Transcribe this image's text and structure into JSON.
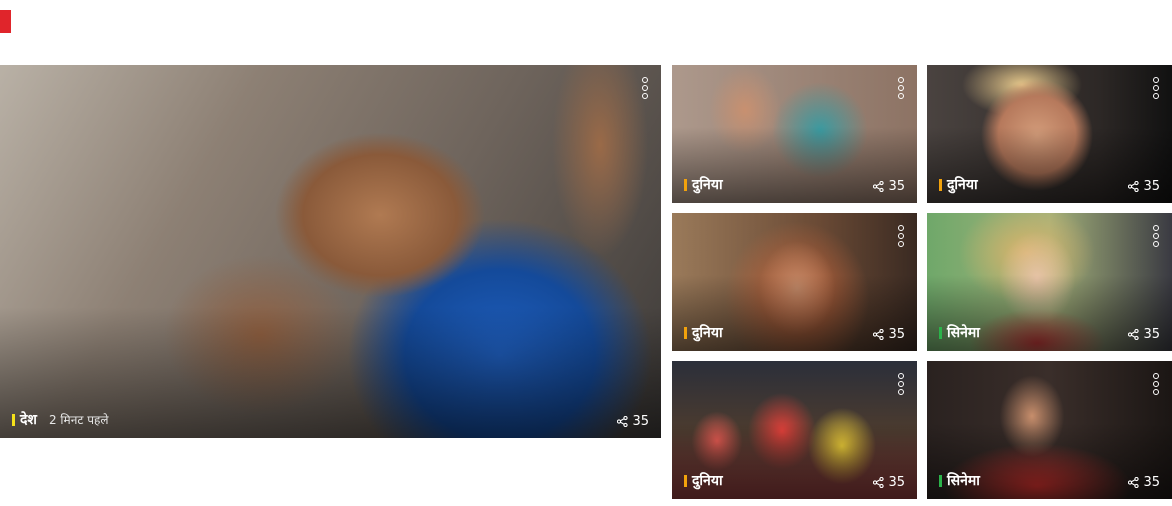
{
  "accent_color": "#e0252b",
  "hero": {
    "category": "देश",
    "category_color": "#f5e11a",
    "time": "2 मिनट पहले",
    "shares": "35"
  },
  "cards": [
    {
      "category": "दुनिया",
      "category_color": "#f2a20c",
      "shares": "35"
    },
    {
      "category": "दुनिया",
      "category_color": "#f2a20c",
      "shares": "35"
    },
    {
      "category": "दुनिया",
      "category_color": "#f2a20c",
      "shares": "35"
    },
    {
      "category": "सिनेमा",
      "category_color": "#2bb34a",
      "shares": "35"
    },
    {
      "category": "दुनिया",
      "category_color": "#f2a20c",
      "shares": "35"
    },
    {
      "category": "सिनेमा",
      "category_color": "#2bb34a",
      "shares": "35"
    }
  ],
  "icons": {
    "more": "more-options-icon",
    "share": "share-icon"
  }
}
